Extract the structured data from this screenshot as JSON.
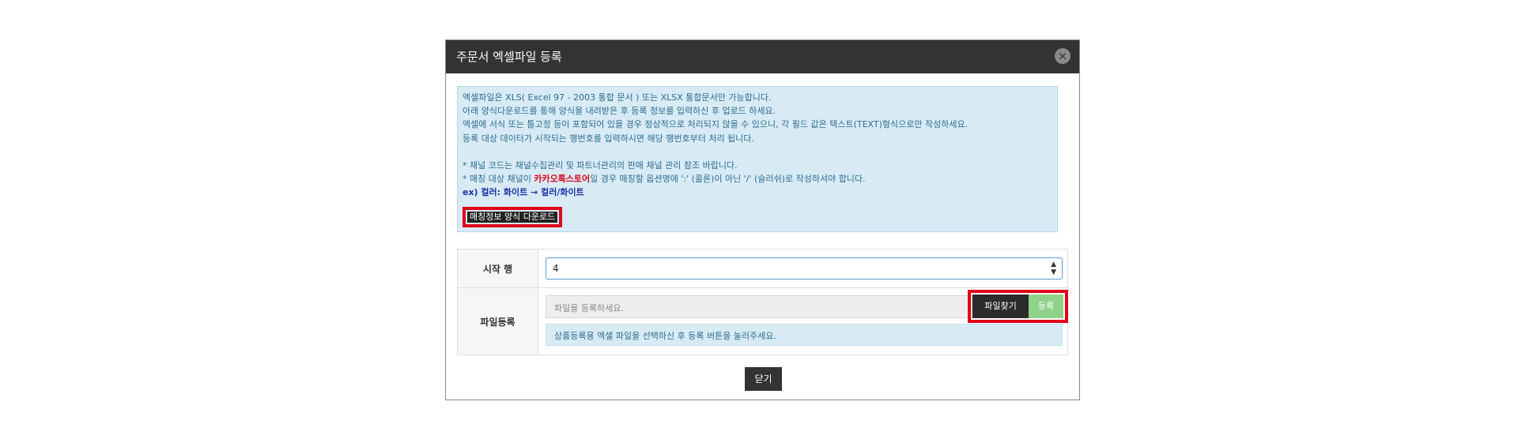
{
  "modal": {
    "title": "주문서 엑셀파일 등록",
    "close_icon": "×",
    "info_lines": [
      "엑셀파일은 XLS( Excel 97 - 2003 통합 문서 ) 또는 XLSX 통합문서만 가능합니다.",
      "아래 양식다운로드를 통해 양식을 내려받은 후 등록 정보를 입력하신 후 업로드 하세요.",
      "엑셀에 서식 또는 틀고정 등이 포함되어 있을 경우 정상적으로 처리되지 않을 수 있으니, 각 필드 값은 텍스트(TEXT)형식으로만 작성하세요.",
      "등록 대상 데이터가 시작되는 행번호를 입력하시면 해당 행번호부터 처리 됩니다."
    ],
    "note1": "* 채널 코드는 채널수집관리 및 파트너관리의 판매 채널 관리 참조 바랍니다.",
    "note2_prefix": "* 매칭 대상 채널이 ",
    "note2_highlight": "카카오톡스토어",
    "note2_suffix": "일 경우 매칭할 옵션명에 ':' (콜론)이 아닌 '/' (슬러쉬)로 작성하셔야 합니다.",
    "example": "ex) 컬러: 화이트 → 컬러/화이트",
    "download_button": "매칭정보 양식 다운로드",
    "start_row_label": "시작 행",
    "start_row_value": "4",
    "file_label": "파일등록",
    "file_placeholder": "파일을 등록하세요.",
    "find_button": "파일찾기",
    "register_button": "등록",
    "file_note": "상품등록용 엑셀 파일을 선택하신 후 등록 버튼을 눌러주세요.",
    "close_button": "닫기"
  },
  "colors": {
    "header_bg": "#333333",
    "info_bg": "#d8ebf5",
    "highlight_border": "#e0001a",
    "register_green": "#8fd18a"
  }
}
